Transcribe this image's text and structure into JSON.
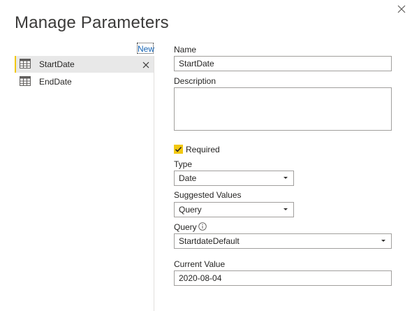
{
  "dialog": {
    "title": "Manage Parameters",
    "close_icon": "close-icon"
  },
  "sidebar": {
    "new_label": "New",
    "items": [
      {
        "label": "StartDate",
        "icon": "table-icon",
        "selected": true,
        "delete_icon": "close-icon"
      },
      {
        "label": "EndDate",
        "icon": "table-icon",
        "selected": false
      }
    ]
  },
  "form": {
    "name_label": "Name",
    "name_value": "StartDate",
    "description_label": "Description",
    "description_value": "",
    "required_label": "Required",
    "required_checked": true,
    "type_label": "Type",
    "type_value": "Date",
    "suggested_label": "Suggested Values",
    "suggested_value": "Query",
    "query_label": "Query",
    "query_value": "StartdateDefault",
    "current_value_label": "Current Value",
    "current_value": "2020-08-04"
  },
  "colors": {
    "accent": "#f2c811",
    "link": "#1664b4",
    "selected_bg": "#e8e8e8"
  }
}
